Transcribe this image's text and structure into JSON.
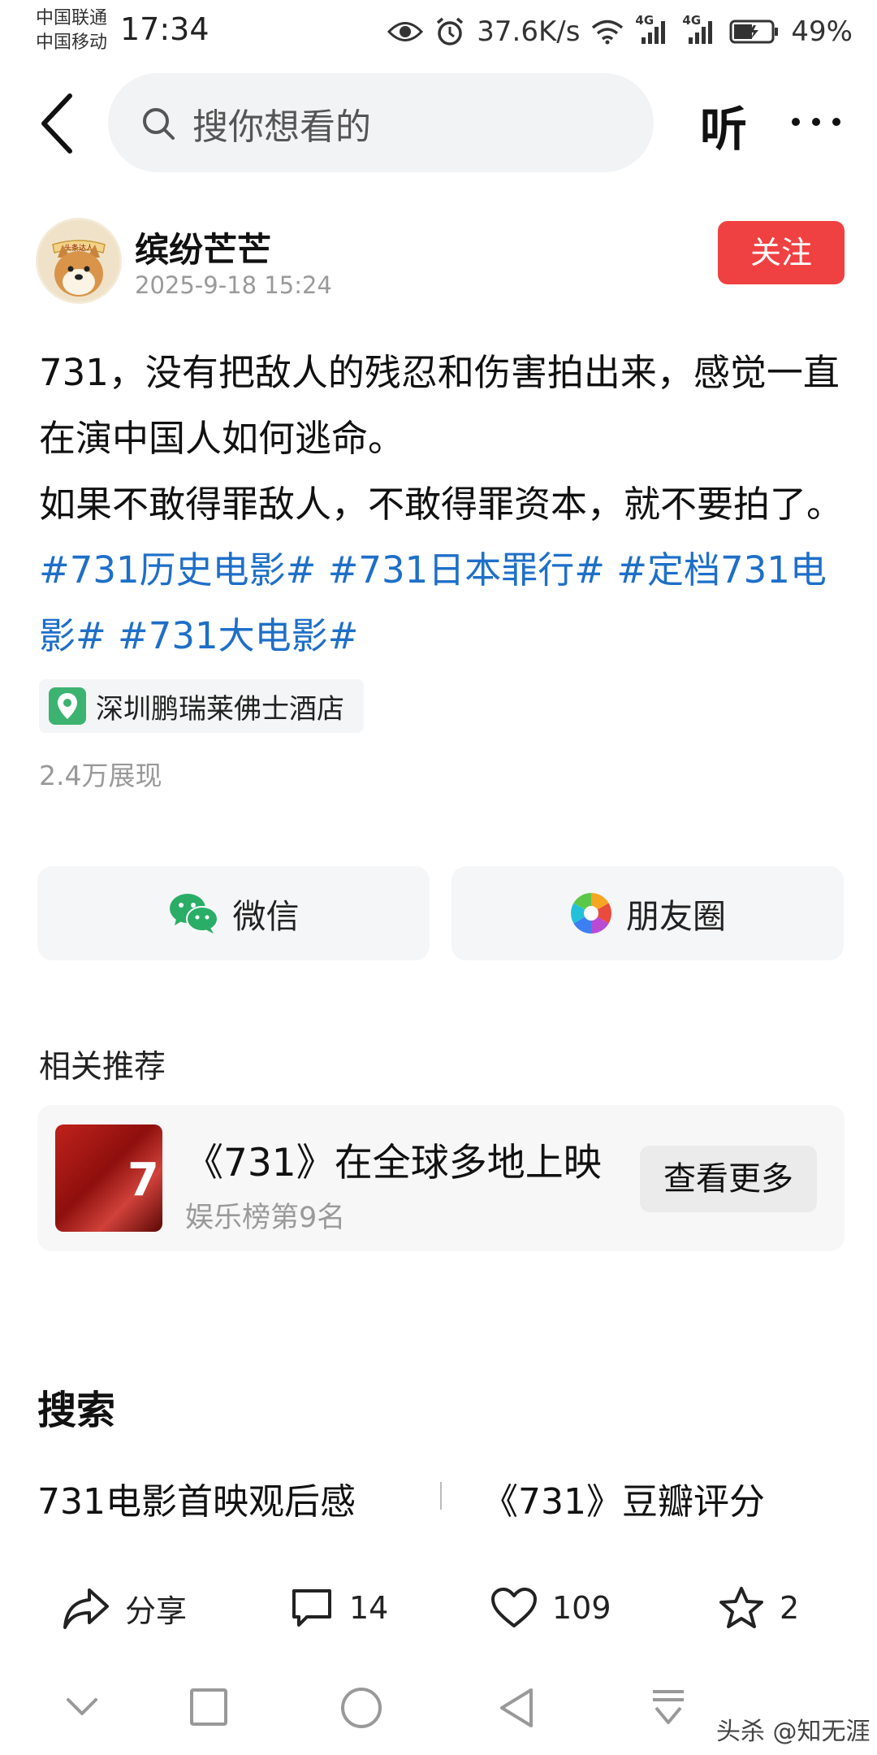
{
  "status_bar": {
    "carrier_1": "中国联通",
    "carrier_2": "中国移动",
    "time": "17:34",
    "net_speed": "37.6K/s",
    "signal_1_label": "4G",
    "signal_2_label": "4G",
    "battery": "49%",
    "battery_level": 0.49
  },
  "top_nav": {
    "search_placeholder": "搜你想看的",
    "listen_label": "听"
  },
  "author": {
    "name": "缤纷芒芒",
    "time": "2025-9-18 15:24",
    "follow_label": "关注",
    "avatar_banner": "头条达人"
  },
  "post": {
    "text_1": "731，没有把敌人的残忍和伤害拍出来，感觉一直在演中国人如何逃命。",
    "text_2": "如果不敢得罪敌人，不敢得罪资本，就不要拍了。",
    "tags": [
      "#731历史电影#",
      "#731日本罪行#",
      "#定档731电影#",
      "#731大电影#"
    ],
    "location": "深圳鹏瑞莱佛士酒店",
    "views": "2.4万展现"
  },
  "share": {
    "wechat_label": "微信",
    "moments_label": "朋友圈"
  },
  "related": {
    "section_title": "相关推荐",
    "headline": "《731》在全球多地上映",
    "sub": "娱乐榜第9名",
    "thumb_text": "7",
    "more_label": "查看更多"
  },
  "search_section": {
    "title": "搜索",
    "queries": [
      "731电影首映观后感",
      "《731》豆瓣评分"
    ]
  },
  "actions": {
    "share_label": "分享",
    "comments": "14",
    "likes": "109",
    "favorites": "2"
  },
  "watermark": "头杀 @知无涯",
  "colors": {
    "accent_red": "#f04142",
    "tag_blue": "#1e6fc8",
    "location_green": "#3cb371"
  }
}
